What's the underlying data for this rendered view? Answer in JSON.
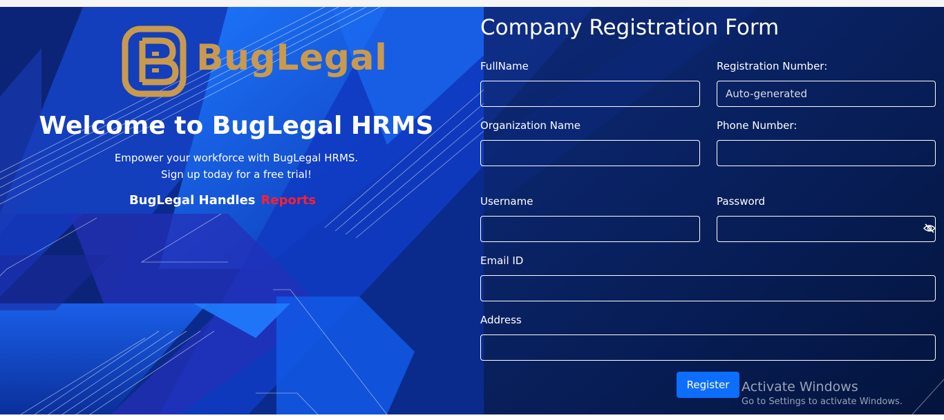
{
  "brand": {
    "name": "BugLegal",
    "logo_color": "#c99a4e"
  },
  "hero": {
    "welcome": "Welcome to BugLegal HRMS",
    "tagline_line1": "Empower your workforce with BugLegal HRMS.",
    "tagline_line2": "Sign up today for a free trial!",
    "handles_prefix": "BugLegal Handles",
    "handles_highlight": "Reports",
    "highlight_color": "#ff1f2f"
  },
  "form": {
    "title": "Company Registration Form",
    "fields": {
      "fullname": {
        "label": "FullName",
        "value": ""
      },
      "registration_number": {
        "label": "Registration Number:",
        "placeholder": "Auto-generated"
      },
      "organization_name": {
        "label": "Organization Name",
        "value": ""
      },
      "phone_number": {
        "label": "Phone Number:",
        "value": ""
      },
      "username": {
        "label": "Username",
        "value": ""
      },
      "password": {
        "label": "Password",
        "value": "",
        "toggle_icon": "eye-slash-icon"
      },
      "email": {
        "label": "Email ID",
        "value": ""
      },
      "address": {
        "label": "Address",
        "value": ""
      }
    },
    "register_label": "Register",
    "accent_color": "#0d6efd"
  },
  "os_overlay": {
    "title": "Activate Windows",
    "subtitle": "Go to Settings to activate Windows."
  },
  "colors": {
    "background_navy": "#041a4e",
    "background_blue": "#1b6cf2"
  }
}
